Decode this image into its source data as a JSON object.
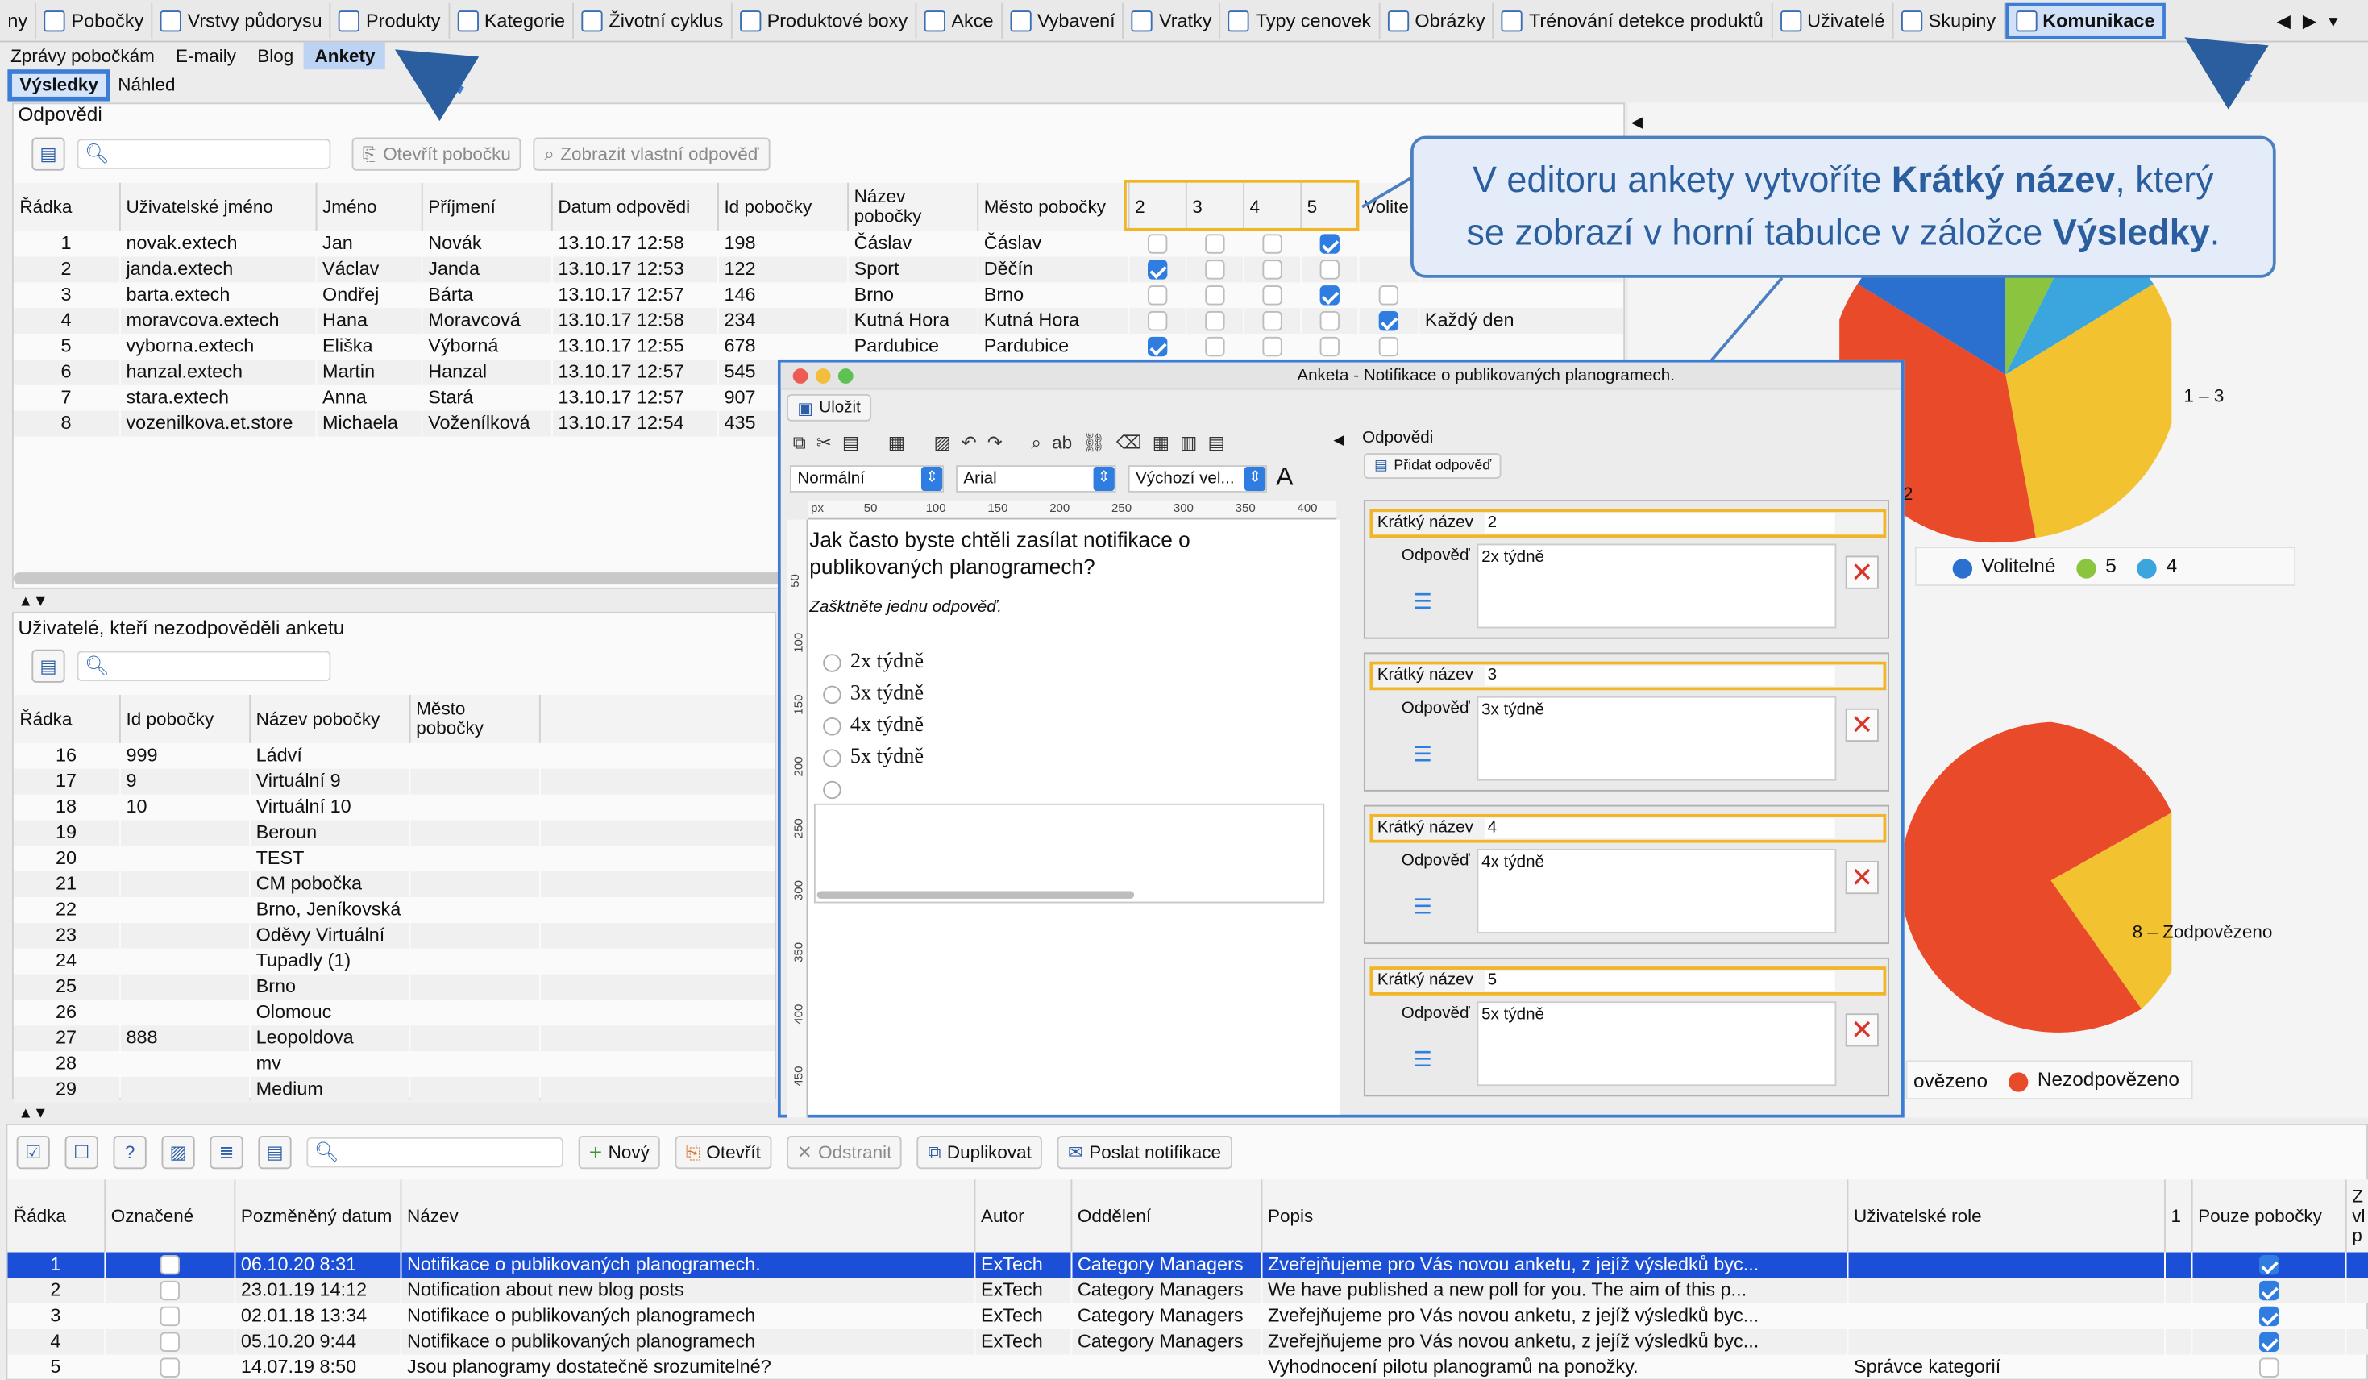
{
  "toolbar": {
    "items": [
      {
        "label": "ny"
      },
      {
        "label": "Pobočky"
      },
      {
        "label": "Vrstvy půdorysu"
      },
      {
        "label": "Produkty"
      },
      {
        "label": "Kategorie"
      },
      {
        "label": "Životní cyklus"
      },
      {
        "label": "Produktové boxy"
      },
      {
        "label": "Akce"
      },
      {
        "label": "Vybavení"
      },
      {
        "label": "Vratky"
      },
      {
        "label": "Typy cenovek"
      },
      {
        "label": "Obrázky"
      },
      {
        "label": "Trénování detekce produktů"
      },
      {
        "label": "Uživatelé"
      },
      {
        "label": "Skupiny"
      },
      {
        "label": "Komunikace"
      }
    ]
  },
  "subtabs": [
    "Zprávy pobočkám",
    "E-maily",
    "Blog",
    "Ankety"
  ],
  "subtabs2": [
    "Výsledky",
    "Náhled"
  ],
  "answers_panel": {
    "title": "Odpovědi",
    "btn_open": "Otevřít pobočku",
    "btn_show": "Zobrazit vlastní odpověď",
    "columns": [
      "Řádka",
      "Uživatelské jméno",
      "Jméno",
      "Příjmení",
      "Datum odpovědi",
      "Id pobočky",
      "Název pobočky",
      "Město pobočky",
      "2",
      "3",
      "4",
      "5",
      "Volite"
    ],
    "rows": [
      {
        "n": "1",
        "user": "novak.extech",
        "jm": "Jan",
        "pr": "Novák",
        "date": "13.10.17 12:58",
        "id": "198",
        "nazev": "Čáslav",
        "mesto": "Čáslav",
        "c": [
          false,
          false,
          false,
          true
        ],
        "extra": ""
      },
      {
        "n": "2",
        "user": "janda.extech",
        "jm": "Václav",
        "pr": "Janda",
        "date": "13.10.17 12:53",
        "id": "122",
        "nazev": "Sport",
        "mesto": "Děčín",
        "c": [
          true,
          false,
          false,
          false
        ],
        "extra": ""
      },
      {
        "n": "3",
        "user": "barta.extech",
        "jm": "Ondřej",
        "pr": "Bárta",
        "date": "13.10.17 12:57",
        "id": "146",
        "nazev": "Brno",
        "mesto": "Brno",
        "c": [
          false,
          false,
          false,
          true
        ],
        "extra": ""
      },
      {
        "n": "4",
        "user": "moravcova.extech",
        "jm": "Hana",
        "pr": "Moravcová",
        "date": "13.10.17 12:58",
        "id": "234",
        "nazev": "Kutná Hora",
        "mesto": "Kutná Hora",
        "c": [
          false,
          false,
          false,
          false
        ],
        "extra": "Každý den"
      },
      {
        "n": "5",
        "user": "vyborna.extech",
        "jm": "Eliška",
        "pr": "Výborná",
        "date": "13.10.17 12:55",
        "id": "678",
        "nazev": "Pardubice",
        "mesto": "Pardubice",
        "c": [
          true,
          false,
          false,
          false
        ],
        "extra": ""
      },
      {
        "n": "6",
        "user": "hanzal.extech",
        "jm": "Martin",
        "pr": "Hanzal",
        "date": "13.10.17 12:57",
        "id": "545",
        "nazev": "",
        "mesto": "",
        "c": null,
        "extra": ""
      },
      {
        "n": "7",
        "user": "stara.extech",
        "jm": "Anna",
        "pr": "Stará",
        "date": "13.10.17 12:57",
        "id": "907",
        "nazev": "",
        "mesto": "",
        "c": null,
        "extra": ""
      },
      {
        "n": "8",
        "user": "vozenilkova.et.store",
        "jm": "Michaela",
        "pr": "Voženílková",
        "date": "13.10.17 12:54",
        "id": "435",
        "nazev": "",
        "mesto": "",
        "c": null,
        "extra": ""
      }
    ]
  },
  "nonresp_panel": {
    "title": "Uživatelé, kteří nezodpověděli anketu",
    "columns": [
      "Řádka",
      "Id pobočky",
      "Název pobočky",
      "Město pobočky"
    ],
    "rows": [
      [
        "16",
        "999",
        "Ládví"
      ],
      [
        "17",
        "9",
        "Virtuální 9"
      ],
      [
        "18",
        "10",
        "Virtuální 10"
      ],
      [
        "19",
        "",
        "Beroun"
      ],
      [
        "20",
        "",
        "TEST"
      ],
      [
        "21",
        "",
        "CM pobočka"
      ],
      [
        "22",
        "",
        "Brno, Jeníkovská"
      ],
      [
        "23",
        "",
        "Oděvy Virtuální"
      ],
      [
        "24",
        "",
        "Tupadly (1)"
      ],
      [
        "25",
        "",
        "Brno"
      ],
      [
        "26",
        "",
        "Olomouc"
      ],
      [
        "27",
        "888",
        "Leopoldova"
      ],
      [
        "28",
        "",
        "mv"
      ],
      [
        "29",
        "",
        "Medium"
      ]
    ]
  },
  "callout": {
    "line1a": "V editoru ankety vytvoříte ",
    "line1b": "Krátký název",
    "line1c": ", který",
    "line2a": "se zobrazí v horní tabulce v záložce ",
    "line2b": "Výsledky",
    "line2c": "."
  },
  "chart_data": [
    {
      "type": "pie",
      "title": "",
      "labels": [
        "1 – 3",
        "2"
      ],
      "legend": [
        "Volitelné",
        "5",
        "4"
      ],
      "legend_colors": [
        "#2b6fcf",
        "#8bc53f",
        "#3aa6dd"
      ],
      "slice_colors": [
        "#2b6fcf",
        "#8bc53f",
        "#3aa6dd",
        "#f2c230",
        "#e84a2a"
      ]
    },
    {
      "type": "pie",
      "title": "",
      "labels": [
        "8 – Zodpovězeno"
      ],
      "legend": [
        "ovězeno",
        "Nezodpovězeno"
      ],
      "legend_colors": [
        "#e84a2a"
      ],
      "slice_colors": [
        "#e84a2a",
        "#f2c230"
      ]
    }
  ],
  "dialog": {
    "title": "Anketa - Notifikace o publikovaných planogramech.",
    "save": "Uložit",
    "style": "Normální",
    "font": "Arial",
    "size": "Výchozí vel...",
    "ruler": [
      "px",
      "50",
      "100",
      "150",
      "200",
      "250",
      "300",
      "350",
      "400"
    ],
    "vruler": [
      "50",
      "100",
      "150",
      "200",
      "250",
      "300",
      "350",
      "400",
      "450"
    ],
    "question": "Jak často byste chtěli zasílat notifikace o publikovaných planogramech?",
    "hint": "Zašktněte jednu odpověď.",
    "options": [
      "2x týdně",
      "3x týdně",
      "4x týdně",
      "5x týdně"
    ],
    "answers_title": "Odpovědi",
    "add_answer": "Přidat odpověď",
    "answers": [
      {
        "kn_label": "Krátký název",
        "kn": "2",
        "od_label": "Odpověď",
        "od": "2x týdně"
      },
      {
        "kn_label": "Krátký název",
        "kn": "3",
        "od_label": "Odpověď",
        "od": "3x týdně"
      },
      {
        "kn_label": "Krátký název",
        "kn": "4",
        "od_label": "Odpověď",
        "od": "4x týdně"
      },
      {
        "kn_label": "Krátký název",
        "kn": "5",
        "od_label": "Odpověď",
        "od": "5x týdně"
      }
    ]
  },
  "bottom": {
    "btn_new": "Nový",
    "btn_open": "Otevřít",
    "btn_delete": "Odstranit",
    "btn_dup": "Duplikovat",
    "btn_notify": "Poslat notifikace",
    "columns": [
      "Řádka",
      "Označené",
      "Pozměněný datum",
      "Název",
      "Autor",
      "Oddělení",
      "Popis",
      "Uživatelské role",
      "1",
      "Pouze pobočky",
      "Z vl p"
    ],
    "rows": [
      {
        "n": "1",
        "date": "06.10.20 8:31",
        "name": "Notifikace o publikovaných planogramech.",
        "autor": "ExTech",
        "odd": "Category Managers",
        "popis": "Zveřejňujeme pro Vás novou anketu, z jejíž výsledků byc...",
        "role": "",
        "only": true
      },
      {
        "n": "2",
        "date": "23.01.19 14:12",
        "name": "Notification about new blog posts",
        "autor": "ExTech",
        "odd": "Category Managers",
        "popis": "We have published a new poll for you. The aim of this p...",
        "role": "",
        "only": true
      },
      {
        "n": "3",
        "date": "02.01.18 13:34",
        "name": "Notifikace o publikovaných planogramech",
        "autor": "ExTech",
        "odd": "Category Managers",
        "popis": "Zveřejňujeme pro Vás novou anketu, z jejíž výsledků byc...",
        "role": "",
        "only": true
      },
      {
        "n": "4",
        "date": "05.10.20 9:44",
        "name": "Notifikace o publikovaných planogramech",
        "autor": "ExTech",
        "odd": "Category Managers",
        "popis": "Zveřejňujeme pro Vás novou anketu, z jejíž výsledků byc...",
        "role": "",
        "only": true
      },
      {
        "n": "5",
        "date": "14.07.19 8:50",
        "name": "Jsou planogramy dostatečně srozumitelné?",
        "autor": "",
        "odd": "",
        "popis": "Vyhodnocení pilotu planogramů na ponožky.",
        "role": "Správce kategorií",
        "only": false
      }
    ]
  }
}
